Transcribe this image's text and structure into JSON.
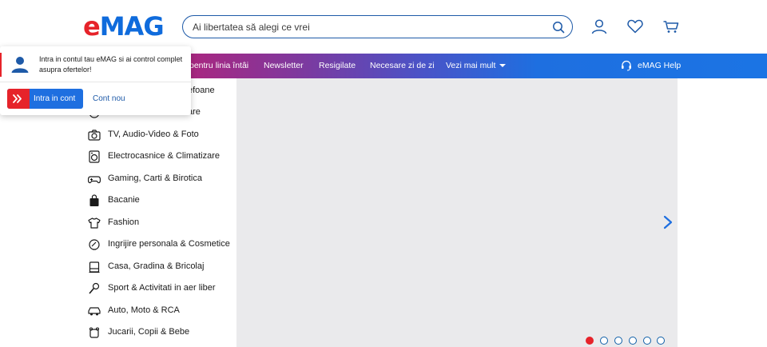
{
  "brand": {
    "logo_e": "e",
    "logo_rest": "MAG",
    "red": "#e6232a",
    "blue": "#0f6bdc"
  },
  "search": {
    "placeholder": "Ai libertatea să alegi ce vrei",
    "icon": "search-icon"
  },
  "header_icons": [
    "account-icon",
    "heart-icon",
    "cart-icon"
  ],
  "nav": {
    "items": [
      {
        "label": "pentru linia întâi"
      },
      {
        "label": "Newsletter"
      },
      {
        "label": "Resigilate"
      },
      {
        "label": "Necesare zi de zi"
      },
      {
        "label": "Vezi mai mult"
      }
    ],
    "help_label": "eMAG Help"
  },
  "categories": [
    {
      "label": "efoane",
      "icon": "phone-icon"
    },
    {
      "label": "are",
      "icon": "laptop-icon"
    },
    {
      "label": "TV, Audio-Video & Foto",
      "icon": "camera-icon"
    },
    {
      "label": "Electrocasnice & Climatizare",
      "icon": "washing-machine-icon"
    },
    {
      "label": "Gaming, Carti & Birotica",
      "icon": "gamepad-icon"
    },
    {
      "label": "Bacanie",
      "icon": "shopping-bag-icon"
    },
    {
      "label": "Fashion",
      "icon": "shirt-icon"
    },
    {
      "label": "Ingrijire personala & Cosmetice",
      "icon": "cosmetics-icon"
    },
    {
      "label": "Casa, Gradina & Bricolaj",
      "icon": "home-icon"
    },
    {
      "label": "Sport & Activitati in aer liber",
      "icon": "sport-icon"
    },
    {
      "label": "Auto, Moto & RCA",
      "icon": "car-icon"
    },
    {
      "label": "Jucarii, Copii & Bebe",
      "icon": "toys-icon"
    }
  ],
  "popover": {
    "text": "Intra in contul tau eMAG si ai control complet asupra ofertelor!",
    "login_button": "Intra in cont",
    "new_account_link": "Cont nou"
  },
  "carousel": {
    "slides": 6,
    "active_index": 0
  }
}
